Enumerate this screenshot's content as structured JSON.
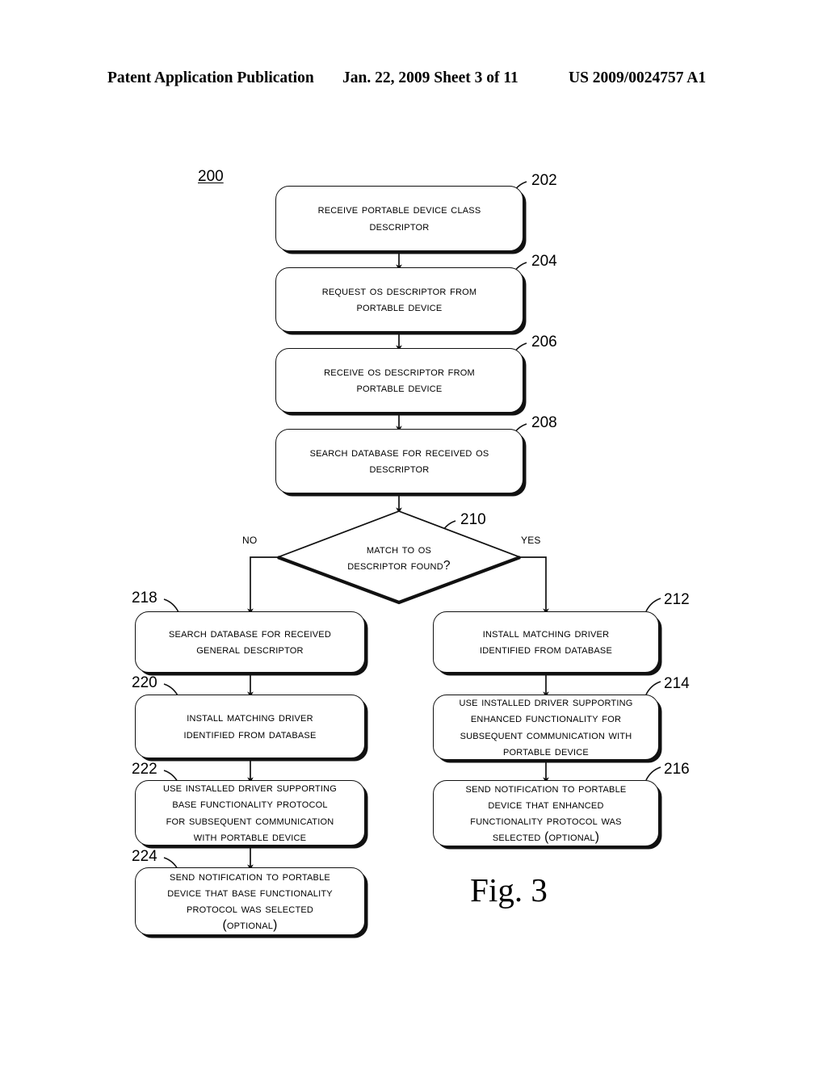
{
  "header": {
    "publication": "Patent Application Publication",
    "date_sheet": "Jan. 22, 2009  Sheet 3 of 11",
    "patent_number": "US 2009/0024757 A1"
  },
  "figure": {
    "caption": "Fig. 3",
    "flow_label": "200"
  },
  "nodes": [
    {
      "ref": "202",
      "text": "Receive Portable Device Class\nDescriptor"
    },
    {
      "ref": "204",
      "text": "Request OS Descriptor from\nPortable Device"
    },
    {
      "ref": "206",
      "text": "Receive OS Descriptor from\nPortable Device"
    },
    {
      "ref": "208",
      "text": "Search Database for Received OS\nDescriptor"
    },
    {
      "ref": "210",
      "text": "Match to OS\nDescriptor Found?"
    },
    {
      "ref": "212",
      "text": "Install Matching Driver\nIdentified from Database"
    },
    {
      "ref": "214",
      "text": "Use Installed Driver Supporting\nEnhanced Functionality for\nSubsequent Communication with\nPortable Device"
    },
    {
      "ref": "216",
      "text": "Send Notification to Portable\nDevice that Enhanced\nFunctionality Protocol was\nSelected (Optional)"
    },
    {
      "ref": "218",
      "text": "Search Database for Received\nGeneral Descriptor"
    },
    {
      "ref": "220",
      "text": "Install Matching Driver\nIdentified from Database"
    },
    {
      "ref": "222",
      "text": "Use Installed Driver Supporting\nBase Functionality Protocol\nfor Subsequent Communication\nwith Portable Device"
    },
    {
      "ref": "224",
      "text": "Send Notification to Portable\nDevice that Base Functionality\nProtocol was Selected\n(Optional)"
    }
  ],
  "branches": {
    "no_label": "No",
    "yes_label": "Yes"
  }
}
